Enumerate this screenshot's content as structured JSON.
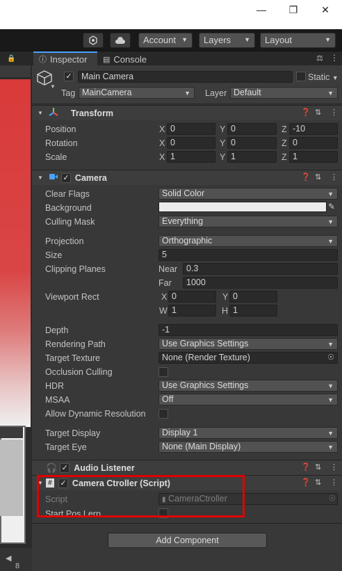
{
  "window": {
    "minimize_icon": "minimize-icon",
    "maximize_icon": "maximize-icon",
    "close_icon": "close-icon"
  },
  "toolbar": {
    "account": "Account",
    "layers": "Layers",
    "layout": "Layout"
  },
  "tabs": {
    "inspector": "Inspector",
    "console": "Console"
  },
  "object": {
    "name": "Main Camera",
    "static_label": "Static",
    "tag_label": "Tag",
    "tag": "MainCamera",
    "layer_label": "Layer",
    "layer": "Default"
  },
  "transform": {
    "title": "Transform",
    "rows": [
      {
        "label": "Position",
        "x": "0",
        "y": "0",
        "z": "-10"
      },
      {
        "label": "Rotation",
        "x": "0",
        "y": "0",
        "z": "0"
      },
      {
        "label": "Scale",
        "x": "1",
        "y": "1",
        "z": "1"
      }
    ],
    "x": "X",
    "y": "Y",
    "z": "Z"
  },
  "camera": {
    "title": "Camera",
    "clear_flags_label": "Clear Flags",
    "clear_flags": "Solid Color",
    "background_label": "Background",
    "culling_mask_label": "Culling Mask",
    "culling_mask": "Everything",
    "projection_label": "Projection",
    "projection": "Orthographic",
    "size_label": "Size",
    "size": "5",
    "clipping_label": "Clipping Planes",
    "near_label": "Near",
    "near": "0.3",
    "far_label": "Far",
    "far": "1000",
    "viewport_label": "Viewport Rect",
    "vx_label": "X",
    "vx": "0",
    "vy_label": "Y",
    "vy": "0",
    "vw_label": "W",
    "vw": "1",
    "vh_label": "H",
    "vh": "1",
    "depth_label": "Depth",
    "depth": "-1",
    "rendering_path_label": "Rendering Path",
    "rendering_path": "Use Graphics Settings",
    "target_texture_label": "Target Texture",
    "target_texture": "None (Render Texture)",
    "occlusion_label": "Occlusion Culling",
    "hdr_label": "HDR",
    "hdr": "Use Graphics Settings",
    "msaa_label": "MSAA",
    "msaa": "Off",
    "dyn_res_label": "Allow Dynamic Resolution",
    "target_display_label": "Target Display",
    "target_display": "Display 1",
    "target_eye_label": "Target Eye",
    "target_eye": "None (Main Display)"
  },
  "audio": {
    "title": "Audio Listener"
  },
  "script": {
    "title": "Camera Ctroller (Script)",
    "script_label": "Script",
    "script_value": "CameraCtroller",
    "start_pos_label": "Start Pos Lerp"
  },
  "add_component": "Add Component",
  "scene_footer": "8",
  "colors": {
    "highlight": "#e00000",
    "scene_red": "#d93a3a",
    "accent_blue": "#4aa3ff"
  }
}
